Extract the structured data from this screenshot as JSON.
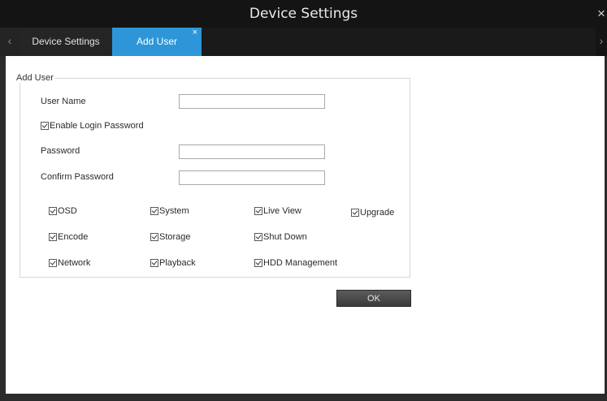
{
  "window": {
    "title": "Device Settings",
    "close_glyph": "×"
  },
  "tabs": {
    "scroll_left": "‹",
    "scroll_right": "›",
    "items": [
      {
        "label": "Device Settings",
        "active": false
      },
      {
        "label": "Add User",
        "active": true,
        "close_glyph": "×"
      }
    ]
  },
  "form": {
    "group_title": "Add User",
    "user_name_label": "User Name",
    "user_name_value": "",
    "enable_login_password_label": "Enable Login Password",
    "enable_login_password_checked": true,
    "password_label": "Password",
    "password_value": "",
    "confirm_password_label": "Confirm Password",
    "confirm_password_value": "",
    "permissions": [
      {
        "label": "OSD",
        "checked": true
      },
      {
        "label": "System",
        "checked": true
      },
      {
        "label": "Live View",
        "checked": true
      },
      {
        "label": "Upgrade",
        "checked": true
      },
      {
        "label": "Encode",
        "checked": true
      },
      {
        "label": "Storage",
        "checked": true
      },
      {
        "label": "Shut Down",
        "checked": true
      },
      {
        "label": "Network",
        "checked": true
      },
      {
        "label": "Playback",
        "checked": true
      },
      {
        "label": "HDD Management",
        "checked": true
      }
    ],
    "ok_label": "OK"
  },
  "colors": {
    "accent": "#2e96d8",
    "titlebar": "#141414",
    "tabbar": "#1a1a1a"
  }
}
